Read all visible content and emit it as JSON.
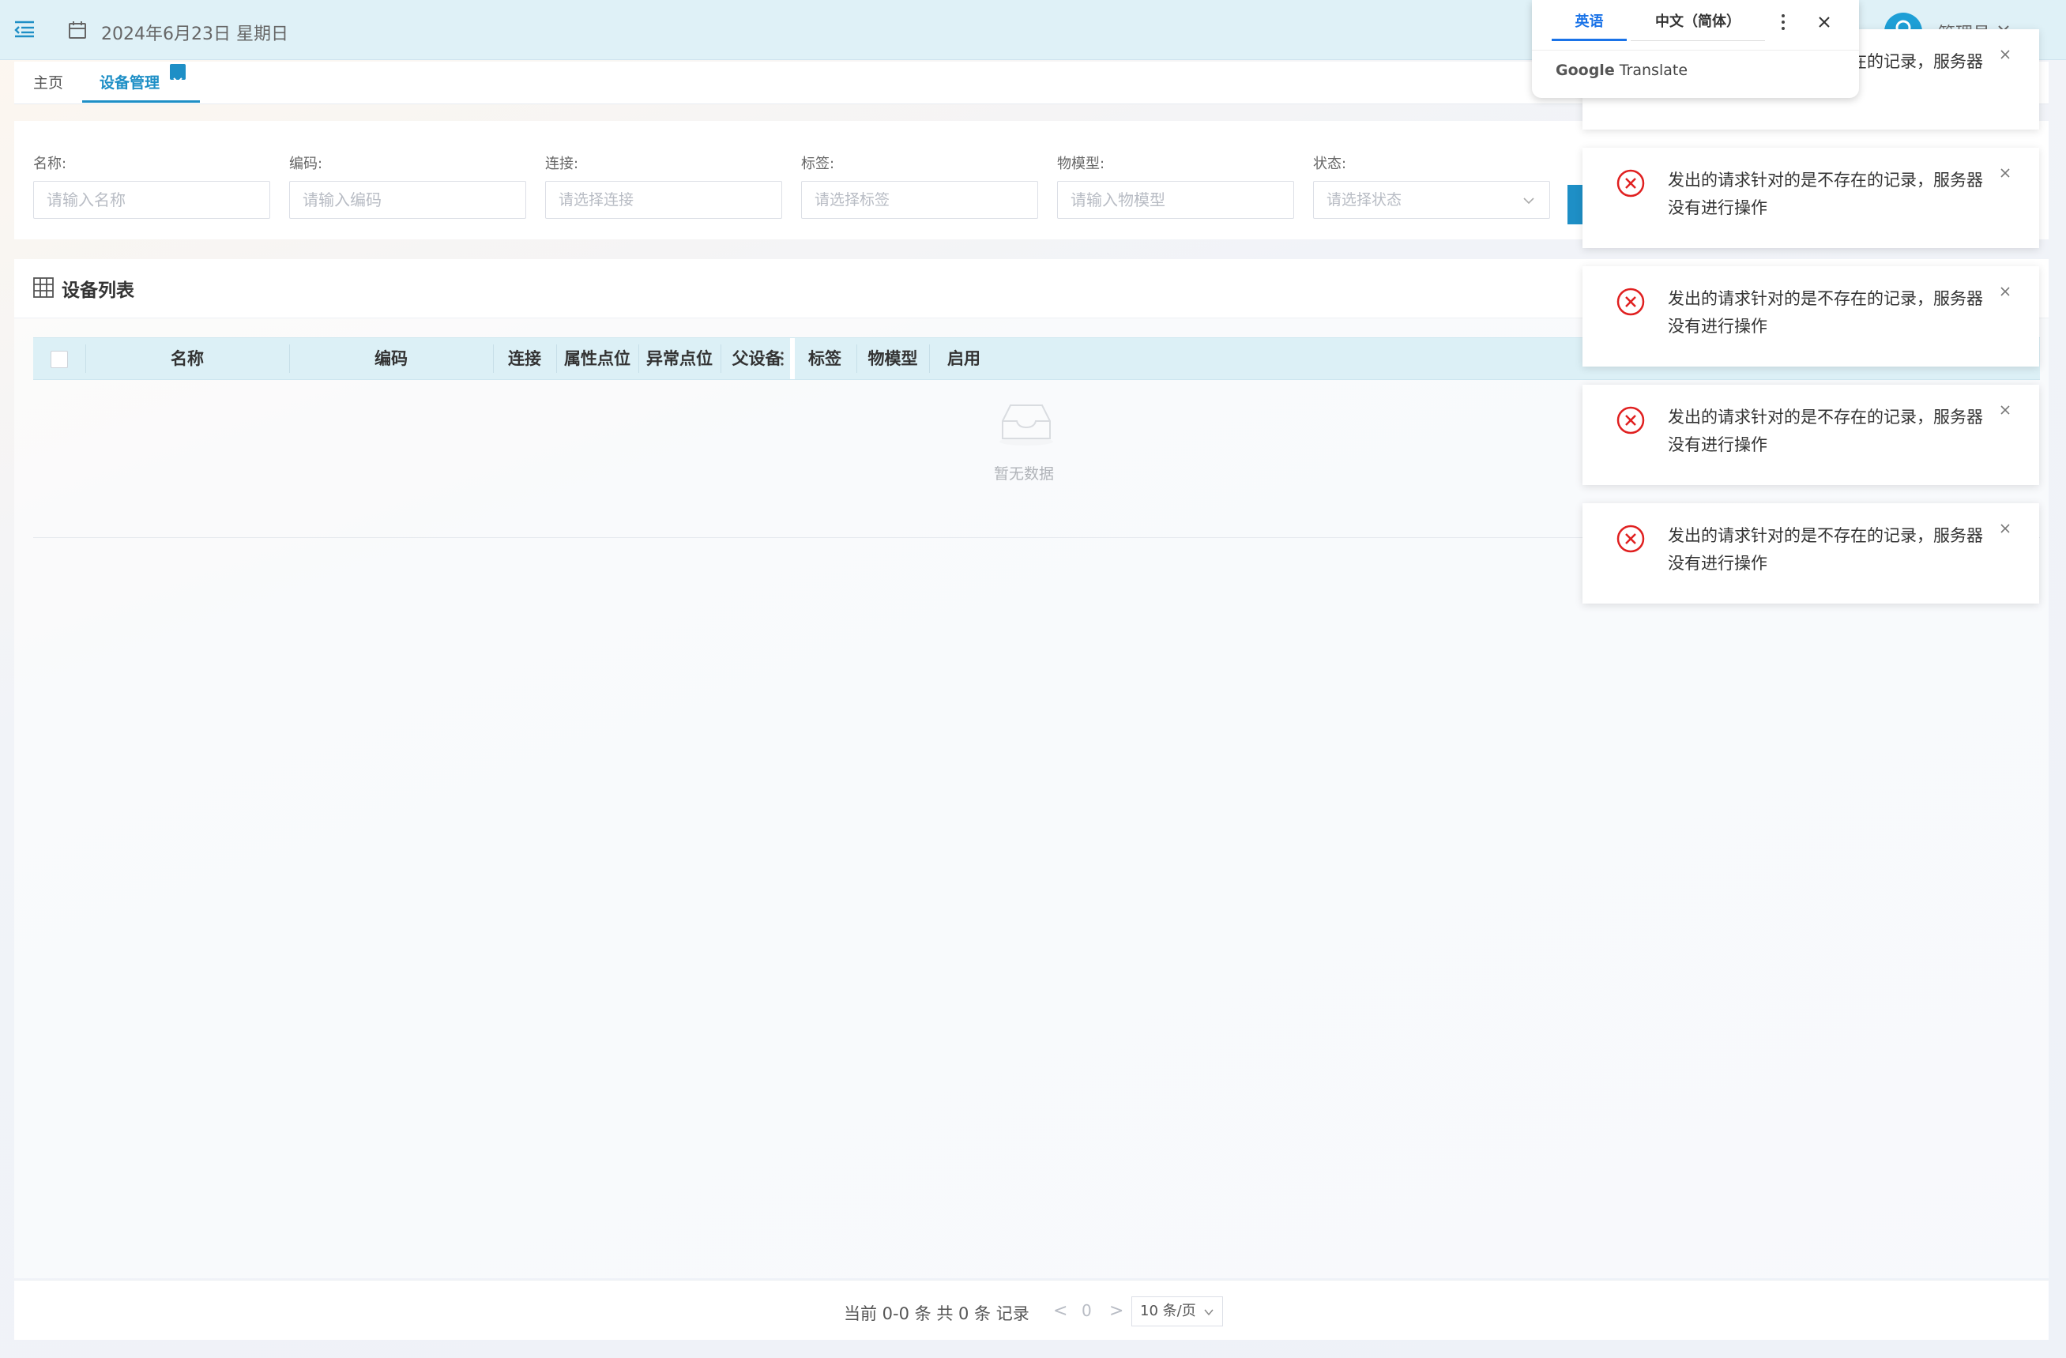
{
  "header": {
    "date_text": "2024年6月23日 星期日",
    "user_name": "管理员"
  },
  "tabs": {
    "home": "主页",
    "device": "设备管理"
  },
  "search": {
    "name_label": "名称:",
    "name_placeholder": "请输入名称",
    "code_label": "编码:",
    "code_placeholder": "请输入编码",
    "connection_label": "连接:",
    "connection_placeholder": "请选择连接",
    "tag_label": "标签:",
    "tag_placeholder": "请选择标签",
    "model_label": "物模型:",
    "model_placeholder": "请输入物模型",
    "status_label": "状态:",
    "status_placeholder": "请选择状态"
  },
  "list": {
    "title": "设备列表",
    "columns": [
      "名称",
      "编码",
      "连接",
      "属性点位",
      "异常点位",
      "父设备",
      "标签",
      "物模型",
      "启用"
    ],
    "empty_text": "暂无数据"
  },
  "pager": {
    "info": "当前 0-0 条 共 0 条 记录",
    "prev": "<",
    "page": "0",
    "next": ">",
    "page_size": "10 条/页"
  },
  "toasts": [
    {
      "message": "发出的请求针对的是不存在的记录，服务器没有进行操作"
    },
    {
      "message": "发出的请求针对的是不存在的记录，服务器没有进行操作"
    },
    {
      "message": "发出的请求针对的是不存在的记录，服务器没有进行操作"
    },
    {
      "message": "发出的请求针对的是不存在的记录，服务器没有进行操作"
    },
    {
      "message": "发出的请求针对的是不存在的记录，服务器没有进行操作"
    }
  ],
  "translate": {
    "tab_source": "英语",
    "tab_target": "中文（简体）",
    "brand_google": "Google",
    "brand_translate": "Translate"
  },
  "colors": {
    "primary": "#1e8fc6",
    "header_bg": "#dff1f7",
    "error": "#e02020",
    "google_blue": "#1a73e8"
  },
  "icons": [
    "menu-fold-icon",
    "calendar-icon",
    "user-icon",
    "chevron-down-icon",
    "close-icon",
    "grid-icon",
    "more-vertical-icon",
    "inbox-empty-icon",
    "error-circle-icon"
  ]
}
